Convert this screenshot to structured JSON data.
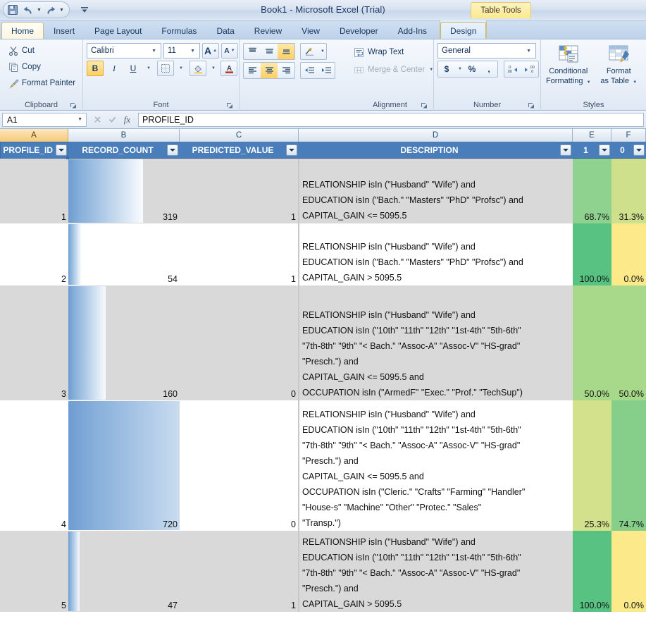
{
  "window": {
    "title": "Book1  -  Microsoft Excel (Trial)",
    "contextual_tab_label": "Table Tools",
    "quick_access": [
      {
        "name": "save-icon",
        "label": "Save"
      },
      {
        "name": "undo-icon",
        "label": "Undo"
      },
      {
        "name": "redo-icon",
        "label": "Redo"
      },
      {
        "name": "customize-qat-icon",
        "label": "Customize Quick Access Toolbar"
      }
    ]
  },
  "ribbon": {
    "tabs": [
      {
        "label": "Home",
        "active": true,
        "contextual": false
      },
      {
        "label": "Insert",
        "active": false,
        "contextual": false
      },
      {
        "label": "Page Layout",
        "active": false,
        "contextual": false
      },
      {
        "label": "Formulas",
        "active": false,
        "contextual": false
      },
      {
        "label": "Data",
        "active": false,
        "contextual": false
      },
      {
        "label": "Review",
        "active": false,
        "contextual": false
      },
      {
        "label": "View",
        "active": false,
        "contextual": false
      },
      {
        "label": "Developer",
        "active": false,
        "contextual": false
      },
      {
        "label": "Add-Ins",
        "active": false,
        "contextual": false
      },
      {
        "label": "Design",
        "active": false,
        "contextual": true
      }
    ],
    "groups": {
      "clipboard": {
        "label": "Clipboard",
        "cut": "Cut",
        "copy": "Copy",
        "format_painter": "Format Painter"
      },
      "font": {
        "label": "Font",
        "font_name": "Calibri",
        "font_size": "11",
        "bold": "B",
        "italic": "I",
        "underline": "U"
      },
      "alignment": {
        "label": "Alignment",
        "wrap_text": "Wrap Text",
        "merge_center": "Merge & Center"
      },
      "number": {
        "label": "Number",
        "format": "General",
        "currency": "$",
        "percent": "%",
        "comma": ","
      },
      "styles": {
        "label": "Styles",
        "conditional_formatting": "Conditional\nFormatting",
        "conditional_formatting_l1": "Conditional",
        "conditional_formatting_l2": "Formatting",
        "format_as_table_l1": "Format",
        "format_as_table_l2": "as Table"
      }
    }
  },
  "formula_bar": {
    "name_box": "A1",
    "formula": "PROFILE_ID"
  },
  "sheet": {
    "column_letters": [
      "A",
      "B",
      "C",
      "D",
      "E",
      "F"
    ],
    "selected_column": "A",
    "headers": [
      "PROFILE_ID",
      "RECORD_COUNT",
      "PREDICTED_VALUE",
      "DESCRIPTION",
      "1",
      "0"
    ],
    "rows": [
      {
        "profile_id": "1",
        "record_count": "319",
        "predicted_value": "1",
        "description_lines": [
          "RELATIONSHIP isIn (\"Husband\" \"Wife\") and",
          "EDUCATION isIn (\"Bach.\" \"Masters\" \"PhD\" \"Profsc\") and",
          "CAPITAL_GAIN <= 5095.5"
        ],
        "pct_one": "68.7%",
        "pct_zero": "31.3%",
        "pct_one_color": "#8fd18e",
        "pct_zero_color": "#cfe08d",
        "bar_ratio": 0.443
      },
      {
        "profile_id": "2",
        "record_count": "54",
        "predicted_value": "1",
        "description_lines": [
          "RELATIONSHIP isIn (\"Husband\" \"Wife\") and",
          "EDUCATION isIn (\"Bach.\" \"Masters\" \"PhD\" \"Profsc\") and",
          "CAPITAL_GAIN > 5095.5"
        ],
        "pct_one": "100.0%",
        "pct_zero": "0.0%",
        "pct_one_color": "#57c282",
        "pct_zero_color": "#fbe98a",
        "bar_ratio": 0.075
      },
      {
        "profile_id": "3",
        "record_count": "160",
        "predicted_value": "0",
        "description_lines": [
          "RELATIONSHIP isIn (\"Husband\" \"Wife\") and",
          "EDUCATION isIn (\"10th\" \"11th\" \"12th\" \"1st-4th\" \"5th-6th\"",
          "\"7th-8th\" \"9th\" \"< Bach.\" \"Assoc-A\" \"Assoc-V\" \"HS-grad\"",
          "\"Presch.\") and",
          "CAPITAL_GAIN <= 5095.5 and",
          "OCCUPATION isIn (\"ArmedF\" \"Exec.\" \"Prof.\" \"TechSup\")"
        ],
        "pct_one": "50.0%",
        "pct_zero": "50.0%",
        "pct_one_color": "#a8d98a",
        "pct_zero_color": "#a8d98a",
        "bar_ratio": 0.222
      },
      {
        "profile_id": "4",
        "record_count": "720",
        "predicted_value": "0",
        "description_lines": [
          "RELATIONSHIP isIn (\"Husband\" \"Wife\") and",
          "EDUCATION isIn (\"10th\" \"11th\" \"12th\" \"1st-4th\" \"5th-6th\"",
          "\"7th-8th\" \"9th\" \"< Bach.\" \"Assoc-A\" \"Assoc-V\" \"HS-grad\"",
          "\"Presch.\") and",
          "CAPITAL_GAIN <= 5095.5 and",
          "OCCUPATION isIn (\"Cleric.\" \"Crafts\" \"Farming\" \"Handler\"",
          "\"House-s\" \"Machine\" \"Other\" \"Protec.\" \"Sales\"",
          "\"Transp.\")"
        ],
        "pct_one": "25.3%",
        "pct_zero": "74.7%",
        "pct_one_color": "#d3e18c",
        "pct_zero_color": "#85cf8b",
        "bar_ratio": 1.0
      },
      {
        "profile_id": "5",
        "record_count": "47",
        "predicted_value": "1",
        "description_lines": [
          "RELATIONSHIP isIn (\"Husband\" \"Wife\") and",
          "EDUCATION isIn (\"10th\" \"11th\" \"12th\" \"1st-4th\" \"5th-6th\"",
          "\"7th-8th\" \"9th\" \"< Bach.\" \"Assoc-A\" \"Assoc-V\" \"HS-grad\"",
          "\"Presch.\") and",
          "CAPITAL_GAIN > 5095.5"
        ],
        "pct_one": "100.0%",
        "pct_zero": "0.0%",
        "pct_one_color": "#57c282",
        "pct_zero_color": "#fbe98a",
        "bar_ratio": 0.065
      }
    ]
  },
  "colors": {
    "table_header_blue": "#4a7ebb",
    "selected_col_header": "#f5cb7e",
    "banded_row": "#d9d9d9",
    "data_bar": "#6e9bd2"
  }
}
